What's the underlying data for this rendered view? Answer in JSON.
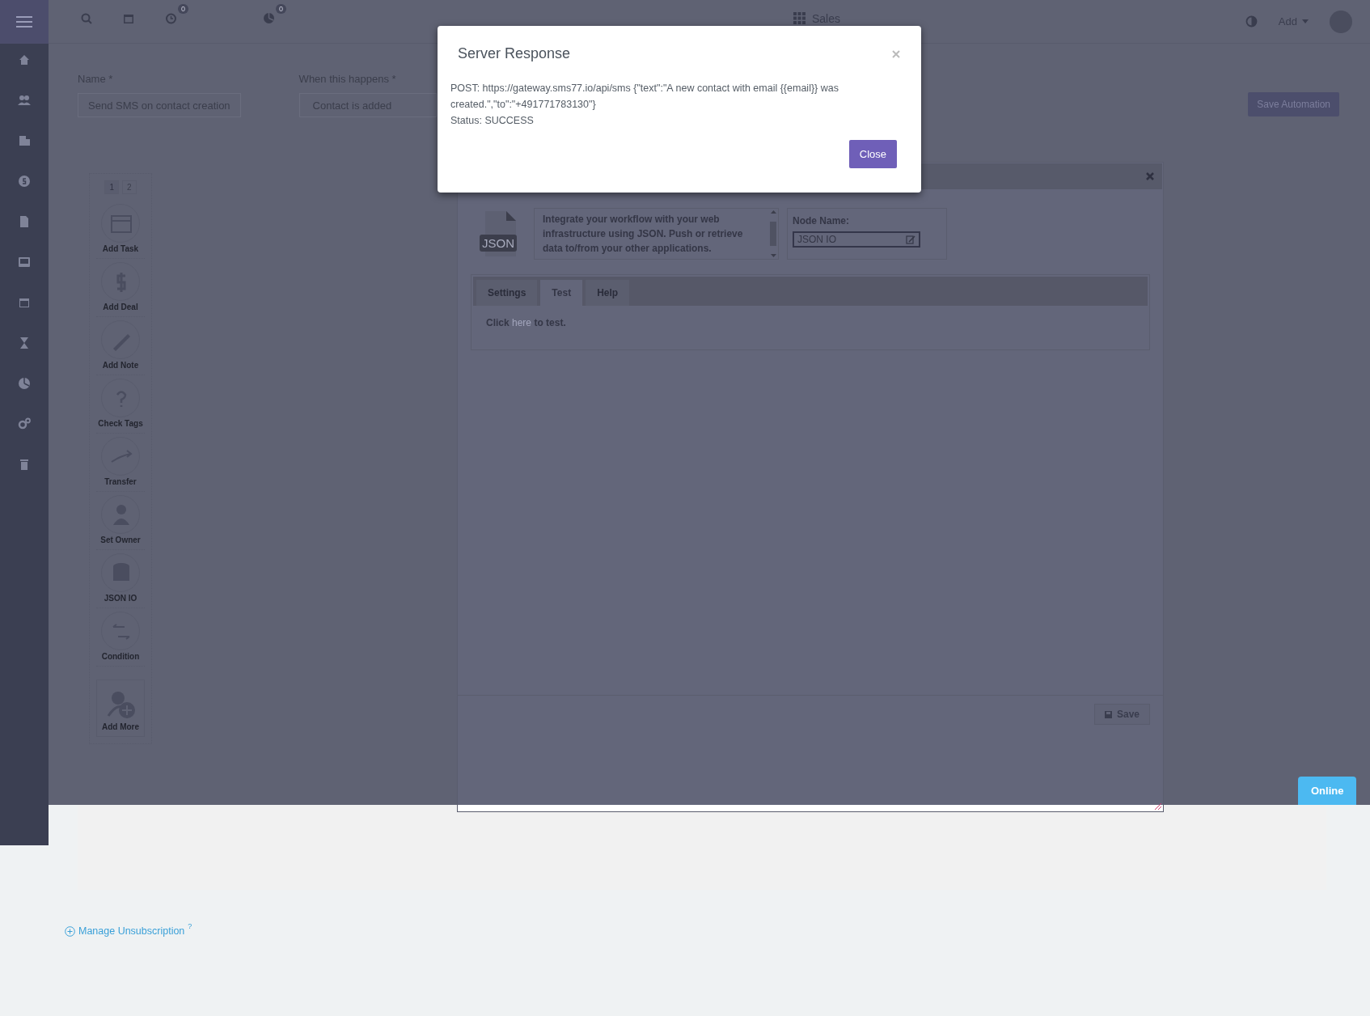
{
  "top_bar": {
    "reminder_badge": "0",
    "report_badge": "0",
    "workspace": "Sales",
    "add_menu": "Add"
  },
  "form": {
    "name_label": "Name *",
    "name_value": "Send SMS on contact creation",
    "trigger_label": "When this happens *",
    "trigger_value": "Contact is added",
    "save_button": "Save Automation"
  },
  "palette": {
    "pages": [
      {
        "label": "1",
        "selected": true
      },
      {
        "label": "2",
        "selected": false
      }
    ],
    "items": [
      {
        "label": "Add Task"
      },
      {
        "label": "Add Deal"
      },
      {
        "label": "Add Note"
      },
      {
        "label": "Check Tags"
      },
      {
        "label": "Transfer"
      },
      {
        "label": "Set Owner"
      },
      {
        "label": "JSON IO"
      },
      {
        "label": "Condition"
      }
    ],
    "add_more": "Add More"
  },
  "node_editor": {
    "icon_label": "JSON",
    "description": "Integrate your workflow with your web infrastructure using JSON. Push or retrieve data to/from your other applications.",
    "node_name_label": "Node Name:",
    "node_name": "JSON IO",
    "tabs": [
      {
        "label": "Settings",
        "selected": false
      },
      {
        "label": "Test",
        "selected": true
      },
      {
        "label": "Help",
        "selected": false
      }
    ],
    "test_before": "Click",
    "test_link": "here",
    "test_after": "to test.",
    "save_button": "Save"
  },
  "modal": {
    "title": "Server Response",
    "lines": [
      "POST: https://gateway.sms77.io/api/sms {\"text\":\"A new contact with email {{email}} was created.\",\"to\":\"+491771783130\"}",
      "Status: SUCCESS"
    ],
    "close_button": "Close"
  },
  "status_badge": "Online",
  "footer": {
    "link": "Manage Unsubscription",
    "help_mark": "?"
  }
}
